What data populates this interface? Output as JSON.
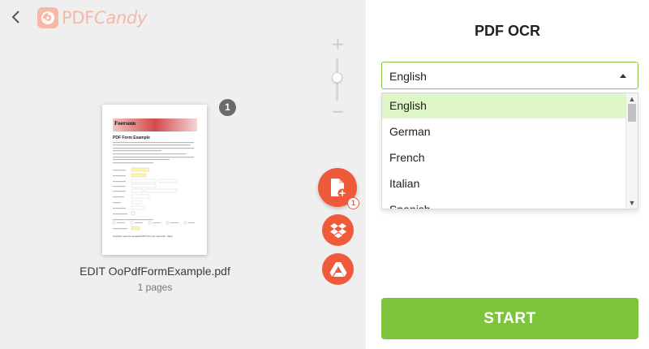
{
  "header": {
    "logo_text_a": "PDF",
    "logo_text_b": "Candy"
  },
  "zoom": {
    "plus": "+",
    "minus": "−",
    "level": 0.55
  },
  "file": {
    "name": "EDIT OoPdfFormExample.pdf",
    "pages": "1 pages",
    "page_badge": "1",
    "preview": {
      "banner": "Foersom",
      "heading": "PDF Form Example",
      "footer": "Important: save the completed PDF form (use menu File - Save)."
    }
  },
  "actions": {
    "add_count": "1"
  },
  "panel": {
    "title": "PDF OCR",
    "selected_language": "English",
    "options": [
      "English",
      "German",
      "French",
      "Italian",
      "Spanish"
    ],
    "start_label": "START"
  },
  "colors": {
    "accent_green": "#7dc43c",
    "select_border": "#8bc34a",
    "selected_option": "#dff7c6",
    "fab_red": "#ef5a3b"
  },
  "icons": {
    "back": "chevron-left-icon",
    "add_file": "file-plus-icon",
    "dropbox": "dropbox-icon",
    "drive": "google-drive-icon"
  }
}
